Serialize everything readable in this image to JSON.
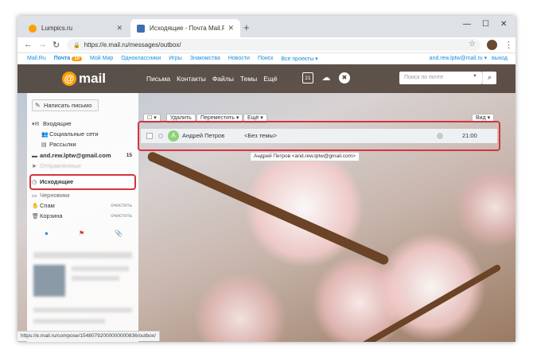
{
  "browser": {
    "tabs": [
      {
        "title": "Lumpics.ru",
        "active": false
      },
      {
        "title": "Исходящие - Почта Mail.Ru",
        "active": true
      }
    ],
    "url": "https://e.mail.ru/messages/outbox/",
    "status_url": "https://e.mail.ru/compose/15480792000000000836/outbox/"
  },
  "portal": {
    "links": [
      "Mail.Ru",
      "Почта",
      "Мой Мир",
      "Одноклассники",
      "Игры",
      "Знакомства",
      "Новости",
      "Поиск",
      "Все проекты ▾"
    ],
    "mail_badge": "10",
    "user": "and.rew.lptw@mail.ru ▾",
    "logout": "выход"
  },
  "header": {
    "logo": "mail",
    "nav": [
      "Письма",
      "Контакты",
      "Файлы",
      "Темы",
      "Ещё"
    ],
    "calendar_day": "21",
    "search_placeholder": "Поиск по почте"
  },
  "sidebar": {
    "compose_label": "Написать письмо",
    "folders": [
      {
        "label": "Входящие"
      },
      {
        "label": "Социальные сети"
      },
      {
        "label": "Рассылки"
      },
      {
        "label": "and.rew.lptw@gmail.com",
        "count": "15"
      },
      {
        "label": "Отправленные"
      },
      {
        "label": "Исходящие"
      },
      {
        "label": "Черновики"
      },
      {
        "label": "Спам",
        "action": "очистить"
      },
      {
        "label": "Корзина",
        "action": "очистить"
      }
    ]
  },
  "toolbar": {
    "select_label": "☐ ▾",
    "delete_label": "Удалить",
    "move_label": "Переместить ▾",
    "more_label": "Ещё ▾",
    "view_label": "Вид ▾"
  },
  "messages": [
    {
      "avatar_letter": "А",
      "sender": "Андрей Петров",
      "subject": "<Без темы>",
      "time": "21:00",
      "tooltip": "Андрей Петров <and.rew.lptw@gmail.com>"
    }
  ],
  "colors": {
    "accent": "#168de2",
    "highlight": "#d6333f",
    "brand": "#ff9e00"
  }
}
